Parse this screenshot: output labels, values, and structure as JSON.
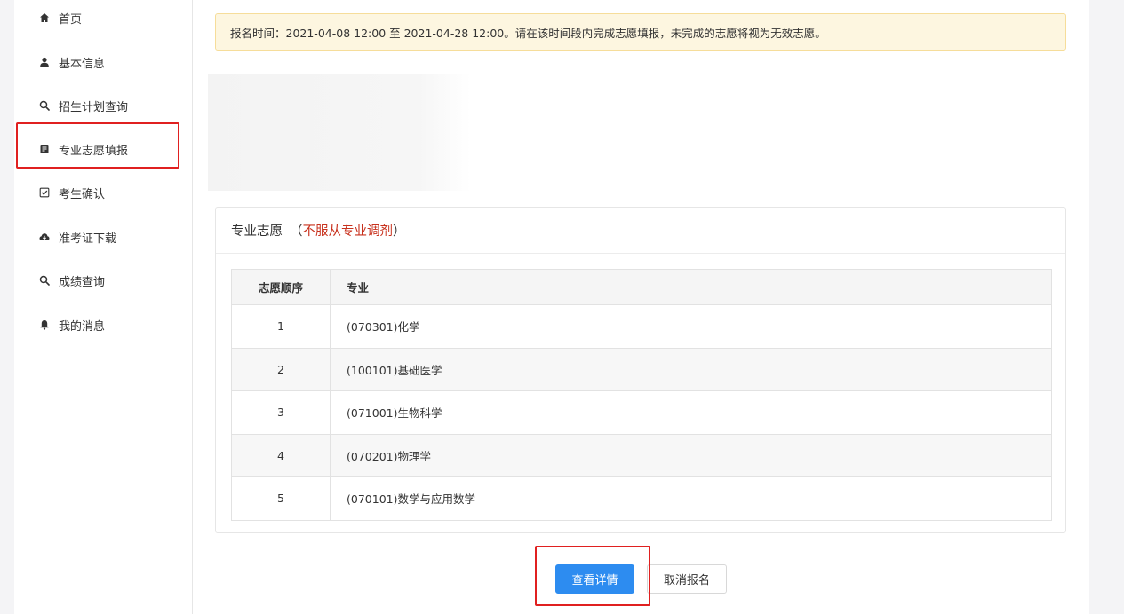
{
  "sidebar": {
    "items": [
      {
        "label": "首页",
        "icon": "home-icon"
      },
      {
        "label": "基本信息",
        "icon": "user-icon"
      },
      {
        "label": "招生计划查询",
        "icon": "search-icon"
      },
      {
        "label": "专业志愿填报",
        "icon": "form-icon",
        "active": true
      },
      {
        "label": "考生确认",
        "icon": "check-square-icon"
      },
      {
        "label": "准考证下载",
        "icon": "cloud-download-icon"
      },
      {
        "label": "成绩查询",
        "icon": "search-icon"
      },
      {
        "label": "我的消息",
        "icon": "bell-icon"
      }
    ]
  },
  "notice": {
    "text": "报名时间：2021-04-08 12:00 至 2021-04-28 12:00。请在该时间段内完成志愿填报，未完成的志愿将视为无效志愿。"
  },
  "panel": {
    "title": "专业志愿",
    "paren_open": "（",
    "note": "不服从专业调剂",
    "paren_close": "）",
    "columns": {
      "order": "志愿顺序",
      "major": "专业"
    },
    "rows": [
      {
        "order": "1",
        "major": "(070301)化学"
      },
      {
        "order": "2",
        "major": "(100101)基础医学"
      },
      {
        "order": "3",
        "major": "(071001)生物科学"
      },
      {
        "order": "4",
        "major": "(070201)物理学"
      },
      {
        "order": "5",
        "major": "(070101)数学与应用数学"
      }
    ]
  },
  "actions": {
    "detail_label": "查看详情",
    "cancel_label": "取消报名"
  },
  "colors": {
    "primary": "#2d8cf0",
    "highlight": "#e02020",
    "note": "#c8321e",
    "notice_bg": "#fdf6e0"
  }
}
